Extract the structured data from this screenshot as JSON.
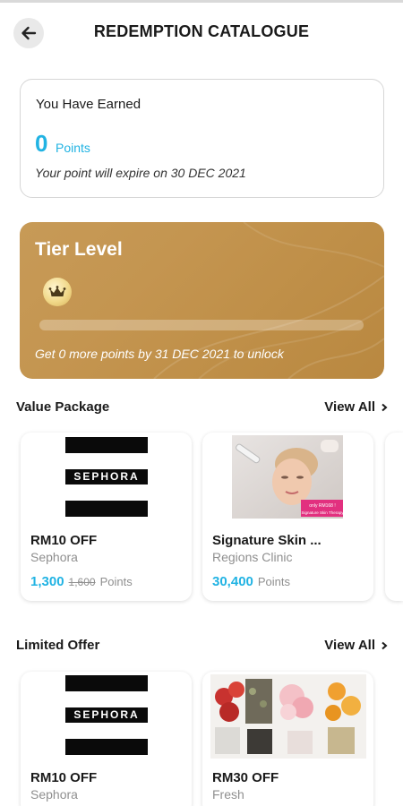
{
  "header": {
    "title": "REDEMPTION CATALOGUE"
  },
  "earned": {
    "title": "You Have Earned",
    "points": "0",
    "points_label": "Points",
    "expiry": "Your point will expire on 30 DEC 2021"
  },
  "tier": {
    "title": "Tier Level",
    "progress": 0,
    "unlock_text": "Get 0 more points by 31 DEC 2021 to unlock"
  },
  "value_package": {
    "title": "Value Package",
    "view_all": "View All",
    "items": [
      {
        "title": "RM10 OFF",
        "brand": "Sephora",
        "price": "1,300",
        "old_price": "1,600",
        "points_label": "Points",
        "logo_text": "SEPHORA"
      },
      {
        "title": "Signature Skin ...",
        "brand": "Regions Clinic",
        "price": "30,400",
        "points_label": "Points",
        "banner_line1": "only RM168 !",
        "banner_line2": "Signature Skin Therapy"
      }
    ]
  },
  "limited_offer": {
    "title": "Limited Offer",
    "view_all": "View All",
    "items": [
      {
        "title": "RM10 OFF",
        "brand": "Sephora",
        "logo_text": "SEPHORA"
      },
      {
        "title": "RM30 OFF",
        "brand": "Fresh"
      }
    ]
  },
  "colors": {
    "accent": "#21b3e3",
    "tier_gold": "#c49550",
    "muted": "#8f8f8f"
  },
  "icons": {
    "back": "arrow-left-icon",
    "crown": "crown-icon",
    "chevron": "chevron-right-icon"
  }
}
